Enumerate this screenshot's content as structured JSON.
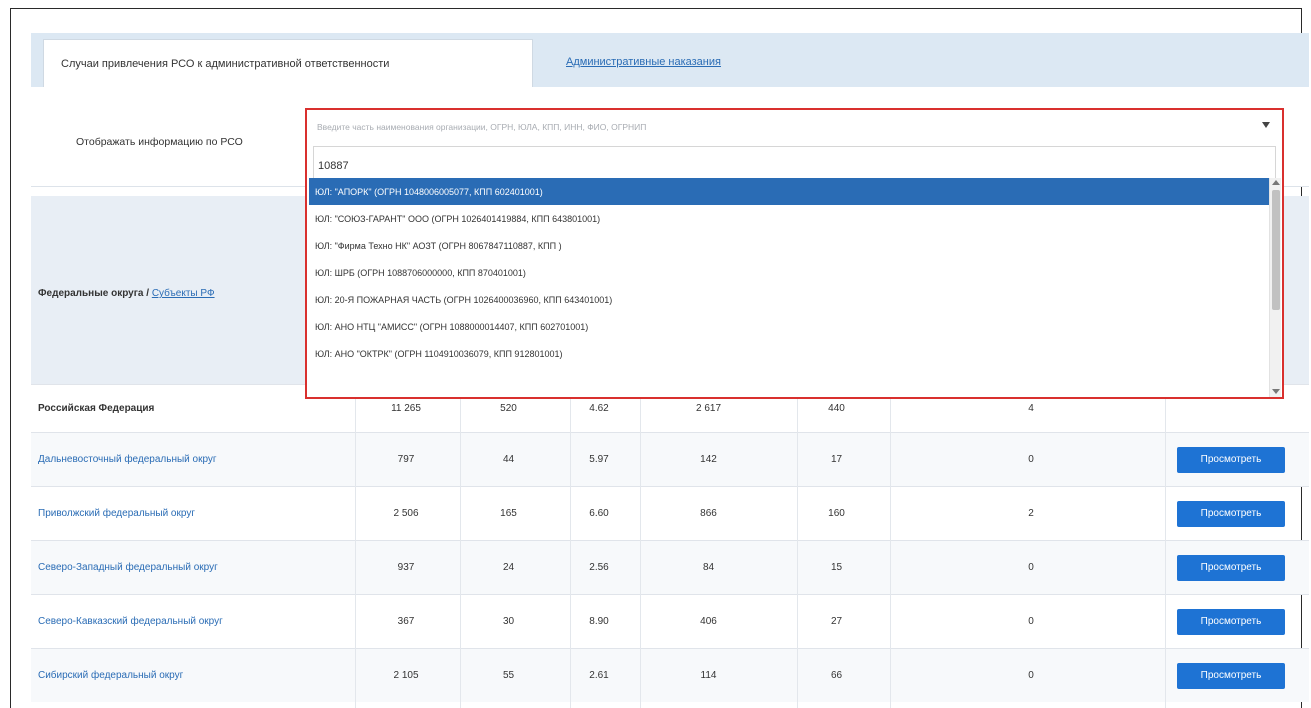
{
  "tabs": {
    "active_label": "Случаи привлечения РСО к административной ответственности",
    "second_label": "Административные наказания"
  },
  "filter": {
    "label": "Отображать информацию по РСО",
    "placeholder": "Введите часть наименования организации, ОГРН, ЮЛА, КПП, ИНН, ФИО, ОГРНИП",
    "search_value": "10887"
  },
  "dropdown": {
    "options": [
      "ЮЛ: \"АПОРК\" (ОГРН 1048006005077, КПП 602401001)",
      "ЮЛ: \"СОЮЗ-ГАРАНТ\" ООО (ОГРН 1026401419884, КПП 643801001)",
      "ЮЛ: \"Фирма Техно НК\" АОЗТ (ОГРН 8067847110887, КПП )",
      "ЮЛ: ШРБ (ОГРН 1088706000000, КПП 870401001)",
      "ЮЛ: 20-Я ПОЖАРНАЯ ЧАСТЬ (ОГРН 1026400036960, КПП 643401001)",
      "ЮЛ: АНО НТЦ \"АМИСС\" (ОГРН 1088000014407, КПП 602701001)",
      "ЮЛ: АНО \"ОКТРК\" (ОГРН 1104910036079, КПП 912801001)"
    ]
  },
  "table": {
    "head_label": "Федеральные округа / ",
    "head_link": "Субъекты РФ",
    "button_label": "Просмотреть",
    "rows": [
      {
        "name": "Российская Федерация",
        "v1": "11 265",
        "v2": "520",
        "v3": "4.62",
        "v4": "2 617",
        "v5": "440",
        "v6": "4"
      },
      {
        "name": "Дальневосточный федеральный округ",
        "v1": "797",
        "v2": "44",
        "v3": "5.97",
        "v4": "142",
        "v5": "17",
        "v6": "0"
      },
      {
        "name": "Приволжский федеральный округ",
        "v1": "2 506",
        "v2": "165",
        "v3": "6.60",
        "v4": "866",
        "v5": "160",
        "v6": "2"
      },
      {
        "name": "Северо-Западный федеральный округ",
        "v1": "937",
        "v2": "24",
        "v3": "2.56",
        "v4": "84",
        "v5": "15",
        "v6": "0"
      },
      {
        "name": "Северо-Кавказский федеральный округ",
        "v1": "367",
        "v2": "30",
        "v3": "8.90",
        "v4": "406",
        "v5": "27",
        "v6": "0"
      },
      {
        "name": "Сибирский федеральный округ",
        "v1": "2 105",
        "v2": "55",
        "v3": "2.61",
        "v4": "114",
        "v5": "66",
        "v6": "0"
      }
    ]
  }
}
